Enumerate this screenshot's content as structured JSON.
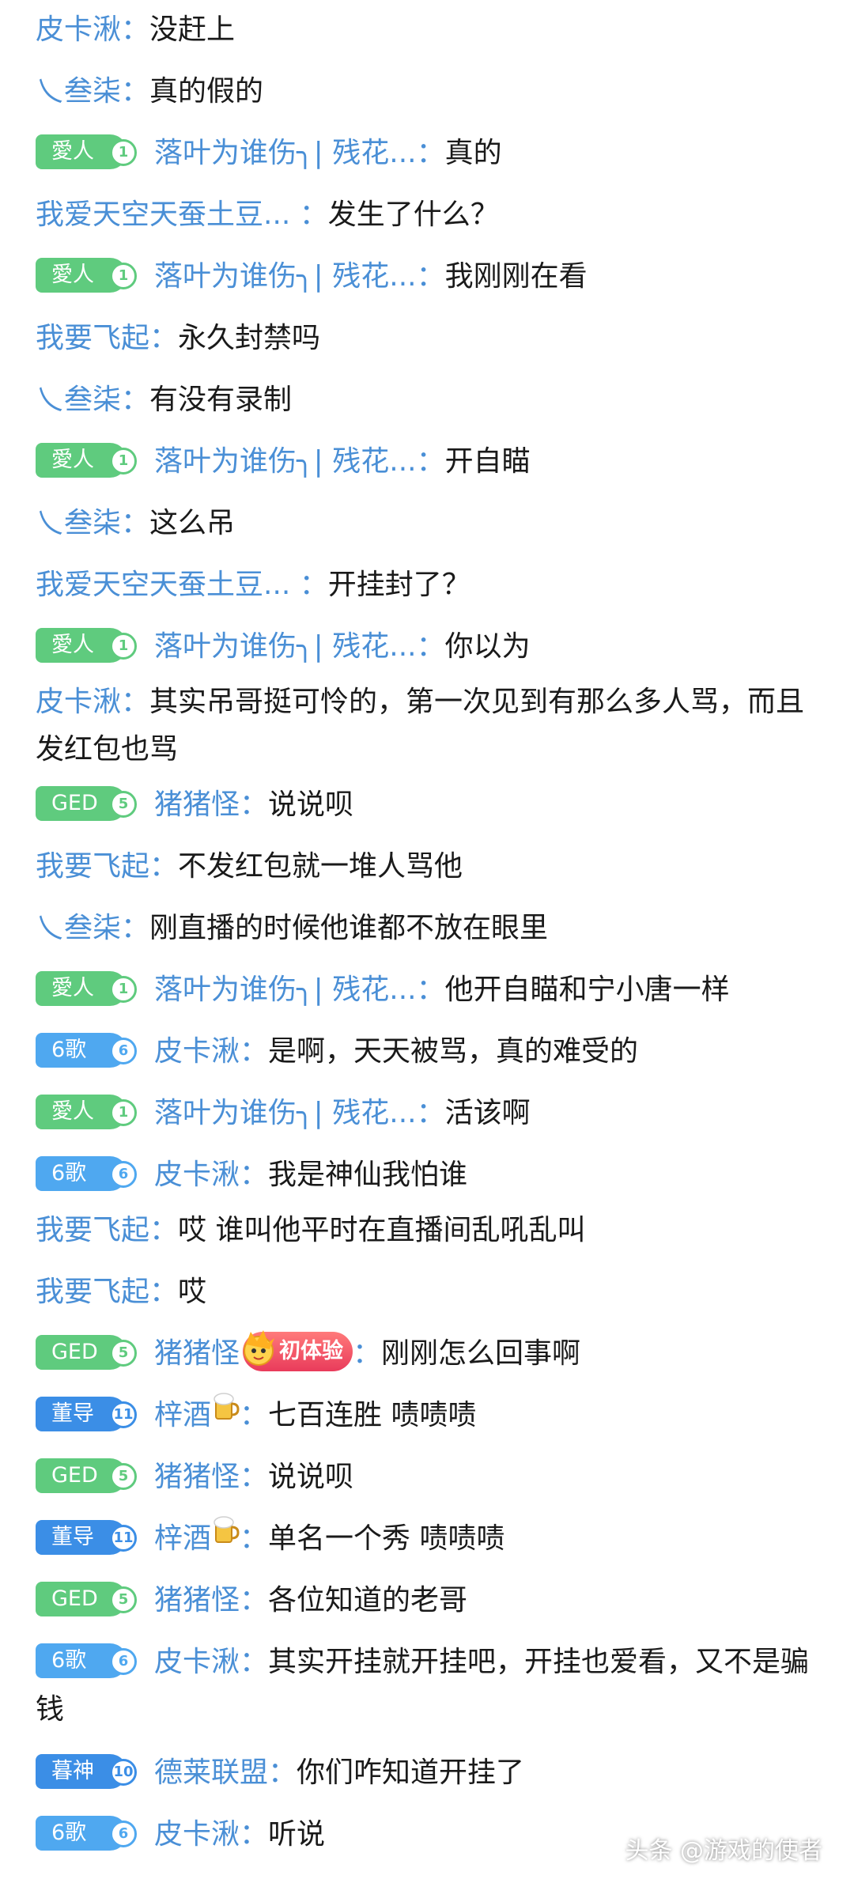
{
  "colors": {
    "name": "#4a8fd6",
    "text": "#1a1a1a",
    "badge_love": "#5fcb7e",
    "badge_ged": "#5fcb7e",
    "badge_6ge": "#4fa8f0",
    "badge_dong": "#4a8fd6",
    "badge_mu": "#3f86d8"
  },
  "badges": {
    "love": {
      "label": "愛人",
      "level": "1",
      "color": "#5fcb7e"
    },
    "ged": {
      "label": "GED",
      "level": "5",
      "color": "#5fcb7e"
    },
    "ge6": {
      "label": "6歌",
      "level": "6",
      "color": "#4fa8f0"
    },
    "dong": {
      "label": "董导",
      "level": "11",
      "color": "#3b8ee6"
    },
    "mu": {
      "label": "暮神",
      "level": "10",
      "color": "#3b8ee6"
    }
  },
  "medal_text": "初体验",
  "messages": [
    {
      "name": "皮卡湫",
      "colon": "：",
      "text": "没赶上"
    },
    {
      "name": "乀叁柒",
      "colon": "：",
      "text": "真的假的"
    },
    {
      "badge": "love",
      "name": "落叶为谁伤╮| 残花...",
      "colon": "：",
      "text": "真的"
    },
    {
      "name": "我爱天空天蚕土豆... ",
      "colon": "：",
      "text": "发生了什么？"
    },
    {
      "badge": "love",
      "name": "落叶为谁伤╮| 残花...",
      "colon": "：",
      "text": "我刚刚在看"
    },
    {
      "name": "我要飞起",
      "colon": "：",
      "text": "永久封禁吗"
    },
    {
      "name": "乀叁柒",
      "colon": "：",
      "text": "有没有录制"
    },
    {
      "badge": "love",
      "name": "落叶为谁伤╮| 残花...",
      "colon": "：",
      "text": "开自瞄"
    },
    {
      "name": "乀叁柒",
      "colon": "：",
      "text": "这么吊"
    },
    {
      "name": "我爱天空天蚕土豆... ",
      "colon": "：",
      "text": "开挂封了？"
    },
    {
      "badge": "love",
      "name": "落叶为谁伤╮| 残花...",
      "colon": "：",
      "text": "你以为"
    },
    {
      "name": "皮卡湫",
      "colon": "：",
      "text": "其实吊哥挺可怜的，第一次见到有那么多人骂，而且发红包也骂"
    },
    {
      "badge": "ged",
      "name": "猪猪怪",
      "colon": "：",
      "text": "说说呗"
    },
    {
      "name": "我要飞起",
      "colon": "：",
      "text": "不发红包就一堆人骂他"
    },
    {
      "name": "乀叁柒",
      "colon": "：",
      "text": "刚直播的时候他谁都不放在眼里"
    },
    {
      "badge": "love",
      "name": "落叶为谁伤╮| 残花...",
      "colon": "：",
      "text": "他开自瞄和宁小唐一样"
    },
    {
      "badge": "ge6",
      "name": "皮卡湫",
      "colon": "：",
      "text": "是啊，天天被骂，真的难受的"
    },
    {
      "badge": "love",
      "name": "落叶为谁伤╮| 残花...",
      "colon": "：",
      "text": "活该啊"
    },
    {
      "badge": "ge6",
      "name": "皮卡湫",
      "colon": "：",
      "text": "我是神仙我怕谁"
    },
    {
      "name": "我要飞起",
      "colon": "：",
      "text": "哎 谁叫他平时在直播间乱吼乱叫"
    },
    {
      "name": "我要飞起",
      "colon": "：",
      "text": "哎"
    },
    {
      "badge": "ged",
      "name": "猪猪怪",
      "medal": true,
      "colon": "：",
      "text": "刚刚怎么回事啊"
    },
    {
      "badge": "dong",
      "name": "梓酒",
      "emoji": true,
      "colon": "：",
      "text": "七百连胜 啧啧啧"
    },
    {
      "badge": "ged",
      "name": "猪猪怪",
      "colon": "：",
      "text": "说说呗"
    },
    {
      "badge": "dong",
      "name": "梓酒",
      "emoji": true,
      "colon": "：",
      "text": "单名一个秀 啧啧啧"
    },
    {
      "badge": "ged",
      "name": "猪猪怪",
      "colon": "：",
      "text": "各位知道的老哥"
    },
    {
      "badge": "ge6",
      "name": "皮卡湫",
      "colon": "：",
      "text": "其实开挂就开挂吧，开挂也爱看，又不是骗钱"
    },
    {
      "badge": "mu",
      "name": "德莱联盟",
      "colon": "：",
      "text": "你们咋知道开挂了"
    },
    {
      "badge": "ge6",
      "name": "皮卡湫",
      "colon": "：",
      "text": "听说"
    }
  ],
  "watermark": "头条 @游戏的使者"
}
